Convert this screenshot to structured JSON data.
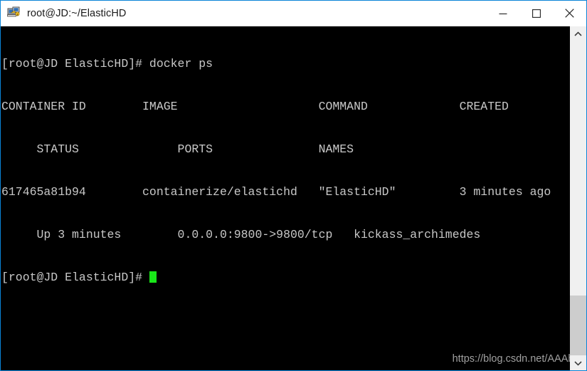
{
  "window": {
    "title": "root@JD:~/ElasticHD",
    "icon": "putty-terminal-icon",
    "border_color": "#0a84d8",
    "titlebar_bg": "#ffffff",
    "controls": {
      "minimize_label": "Minimize",
      "maximize_label": "Maximize",
      "close_label": "Close"
    }
  },
  "terminal": {
    "background": "#000000",
    "foreground": "#c8c8c8",
    "cursor_color": "#19e619",
    "prompt": "[root@JD ElasticHD]#",
    "command": "docker ps",
    "columns": [
      "CONTAINER ID",
      "IMAGE",
      "COMMAND",
      "CREATED",
      "STATUS",
      "PORTS",
      "NAMES"
    ],
    "row": {
      "container_id": "617465a81b94",
      "image": "containerize/elastichd",
      "command": "\"ElasticHD\"",
      "created": "3 minutes ago",
      "status": "Up 3 minutes",
      "ports": "0.0.0.0:9800->9800/tcp",
      "names": "kickass_archimedes"
    },
    "lines": [
      "[root@JD ElasticHD]# docker ps",
      "CONTAINER ID        IMAGE                    COMMAND             CREATED",
      "     STATUS              PORTS               NAMES",
      "617465a81b94        containerize/elastichd   \"ElasticHD\"         3 minutes ago",
      "     Up 3 minutes        0.0.0.0:9800->9800/tcp   kickass_archimedes"
    ],
    "last_prompt": "[root@JD ElasticHD]# "
  },
  "watermark": {
    "text": "https://blog.csdn.net/AAAhxz"
  },
  "scrollbar": {
    "up_arrow": "chevron-up-icon",
    "down_arrow": "chevron-down-icon",
    "thumb_top_percent": 81,
    "thumb_height_percent": 19
  }
}
